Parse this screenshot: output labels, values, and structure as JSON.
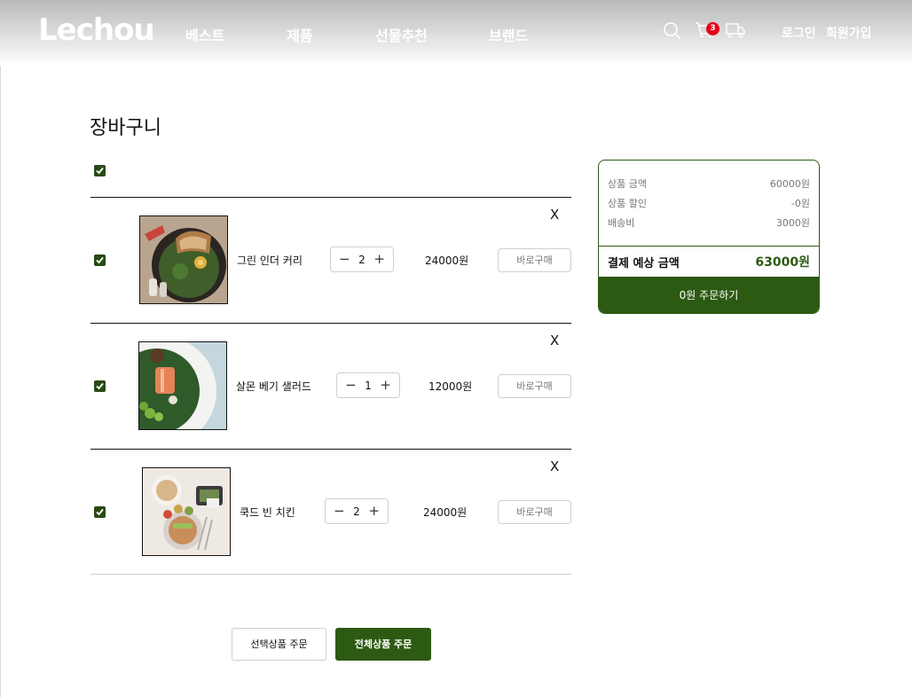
{
  "header": {
    "logo": "Lechou",
    "nav": [
      "베스트",
      "제품",
      "선물추천",
      "브랜드"
    ],
    "cart_count": "3",
    "login": "로그인",
    "signup": "회원가입",
    "icons": [
      "search-icon",
      "cart-icon",
      "delivery-truck-icon"
    ]
  },
  "page": {
    "title": "장바구니"
  },
  "cart": {
    "select_all_checked": true,
    "items": [
      {
        "name": "그린 인더 커리",
        "qty": "2",
        "price": "24000원",
        "buy_label": "바로구매",
        "remove": "X",
        "checked": true
      },
      {
        "name": "살몬 베기 샐러드",
        "qty": "1",
        "price": "12000원",
        "buy_label": "바로구매",
        "remove": "X",
        "checked": true
      },
      {
        "name": "쿡드 빈 치킨",
        "qty": "2",
        "price": "24000원",
        "buy_label": "바로구매",
        "remove": "X",
        "checked": true
      }
    ],
    "minus": "−",
    "plus": "+"
  },
  "summary": {
    "rows": [
      {
        "label": "상품 금액",
        "value": "60000원"
      },
      {
        "label": "상품 할인",
        "value": "-0원"
      },
      {
        "label": "배송비",
        "value": "3000원"
      }
    ],
    "total_label": "결제 예상 금액",
    "total_value": "63000원",
    "order_button": "0원 주문하기"
  },
  "actions": {
    "order_selected": "선택상품 주문",
    "order_all": "전체상품 주문"
  },
  "colors": {
    "accent": "#2d5a12",
    "badge": "#e6001a"
  }
}
